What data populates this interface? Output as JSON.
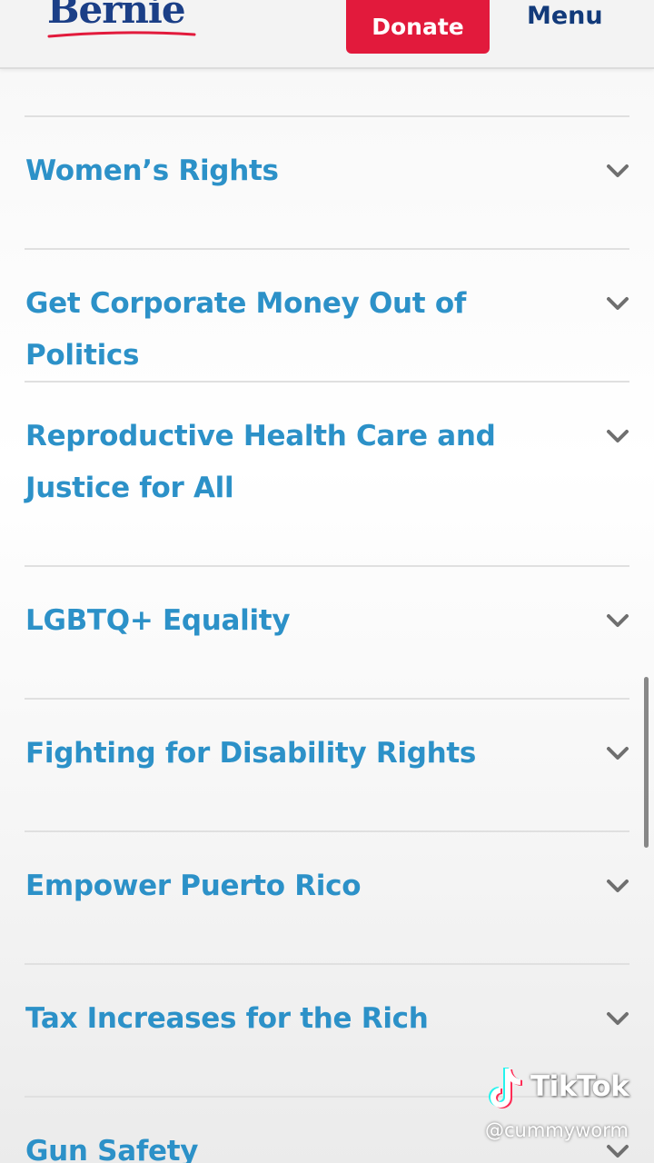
{
  "header": {
    "logo_text": "Bernie",
    "donate_label": "Donate",
    "menu_label": "Menu"
  },
  "colors": {
    "brand_blue": "#1b3f87",
    "donate_red": "#e21a3c",
    "link_blue": "#2c91c8"
  },
  "accordion": {
    "items": [
      {
        "title": "Women’s Rights",
        "icon": "chevron-down-icon"
      },
      {
        "title": "Get Corporate Money Out of Politics",
        "icon": "chevron-down-icon"
      },
      {
        "title": "Reproductive Health Care and Justice for All",
        "icon": "chevron-down-icon"
      },
      {
        "title": "LGBTQ+ Equality",
        "icon": "chevron-down-icon"
      },
      {
        "title": "Fighting for Disability Rights",
        "icon": "chevron-down-icon"
      },
      {
        "title": "Empower Puerto Rico",
        "icon": "chevron-down-icon"
      },
      {
        "title": "Tax Increases for the Rich",
        "icon": "chevron-down-icon"
      },
      {
        "title": "Gun Safety",
        "icon": "chevron-down-icon"
      }
    ]
  },
  "watermark": {
    "brand": "TikTok",
    "username": "@cummyworm"
  }
}
